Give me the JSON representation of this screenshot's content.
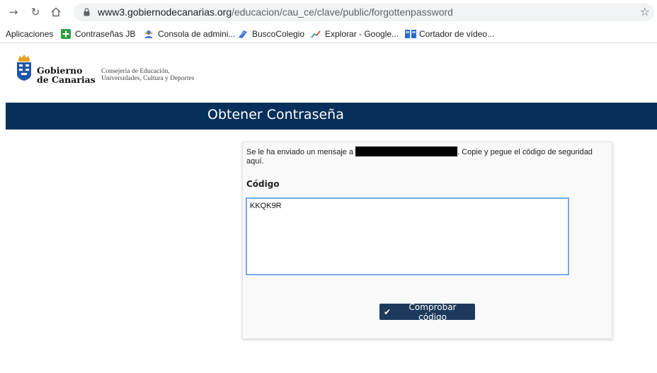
{
  "browser": {
    "url_host": "www3.gobiernodecanarias.org",
    "url_path": "/educacion/cau_ce/clave/public/forgottenpassword",
    "back_icon": "back-arrow-icon",
    "forward_icon": "forward-arrow-icon",
    "reload_icon": "reload-icon",
    "home_icon": "home-icon",
    "lock_icon": "lock-icon",
    "star_icon": "star-icon"
  },
  "bookmarks": [
    {
      "label": "Aplicaciones",
      "icon": "apps-grid-icon"
    },
    {
      "label": "Contraseñas JB",
      "icon": "green-plus-icon"
    },
    {
      "label": "Consola de admini...",
      "icon": "admin-console-icon"
    },
    {
      "label": "BuscoColegio",
      "icon": "buscocolegio-icon"
    },
    {
      "label": "Explorar - Google...",
      "icon": "explore-chart-icon"
    },
    {
      "label": "Cortador de vídeo...",
      "icon": "video-cutter-icon"
    }
  ],
  "header": {
    "logo_line1": "Gobierno",
    "logo_line2": "de Canarias",
    "consejeria_line1": "Consejería de Educación,",
    "consejeria_line2": "Universidades, Cultura y Deportes"
  },
  "page": {
    "title": "Obtener Contraseña"
  },
  "form": {
    "message_before": "Se le ha enviado un mensaje a",
    "message_after": ". Copie y pegue el código de seguridad aquí.",
    "code_label": "Código",
    "code_value": "KKQK9R",
    "submit_label": "Comprobar código"
  },
  "colors": {
    "title_bar": "#06305a",
    "button": "#1d3a5c",
    "input_border": "#7aa9e6"
  }
}
